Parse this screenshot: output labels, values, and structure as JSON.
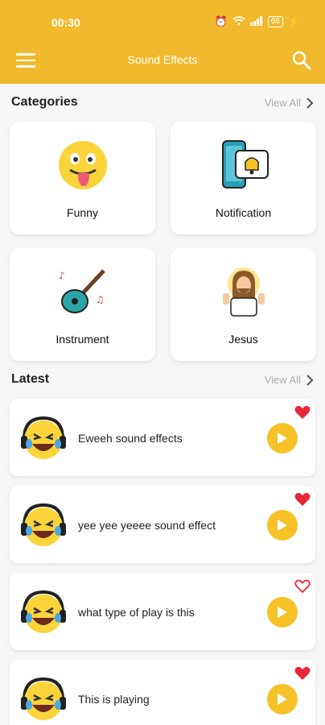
{
  "status_bar": {
    "time": "00:30",
    "battery": "66"
  },
  "header": {
    "title": "Sound Effects",
    "menu_icon": "hamburger-menu-icon",
    "search_icon": "search-icon"
  },
  "colors": {
    "accent": "#f2b92d",
    "play": "#f6c228",
    "heart": "#e8263a"
  },
  "categories": {
    "title": "Categories",
    "view_all": "View All",
    "items": [
      {
        "label": "Funny",
        "icon": "laughing-tongue-emoji-icon"
      },
      {
        "label": "Notification",
        "icon": "phone-bell-notification-icon"
      },
      {
        "label": "Instrument",
        "icon": "guitar-icon"
      },
      {
        "label": "Jesus",
        "icon": "jesus-icon"
      }
    ]
  },
  "latest": {
    "title": "Latest",
    "view_all": "View All",
    "items": [
      {
        "title": "Eweeh sound effects",
        "favorite": true
      },
      {
        "title": "yee yee yeeee sound effect",
        "favorite": true
      },
      {
        "title": "what type of play is this",
        "favorite": false
      },
      {
        "title": "This is playing",
        "favorite": true
      }
    ]
  }
}
